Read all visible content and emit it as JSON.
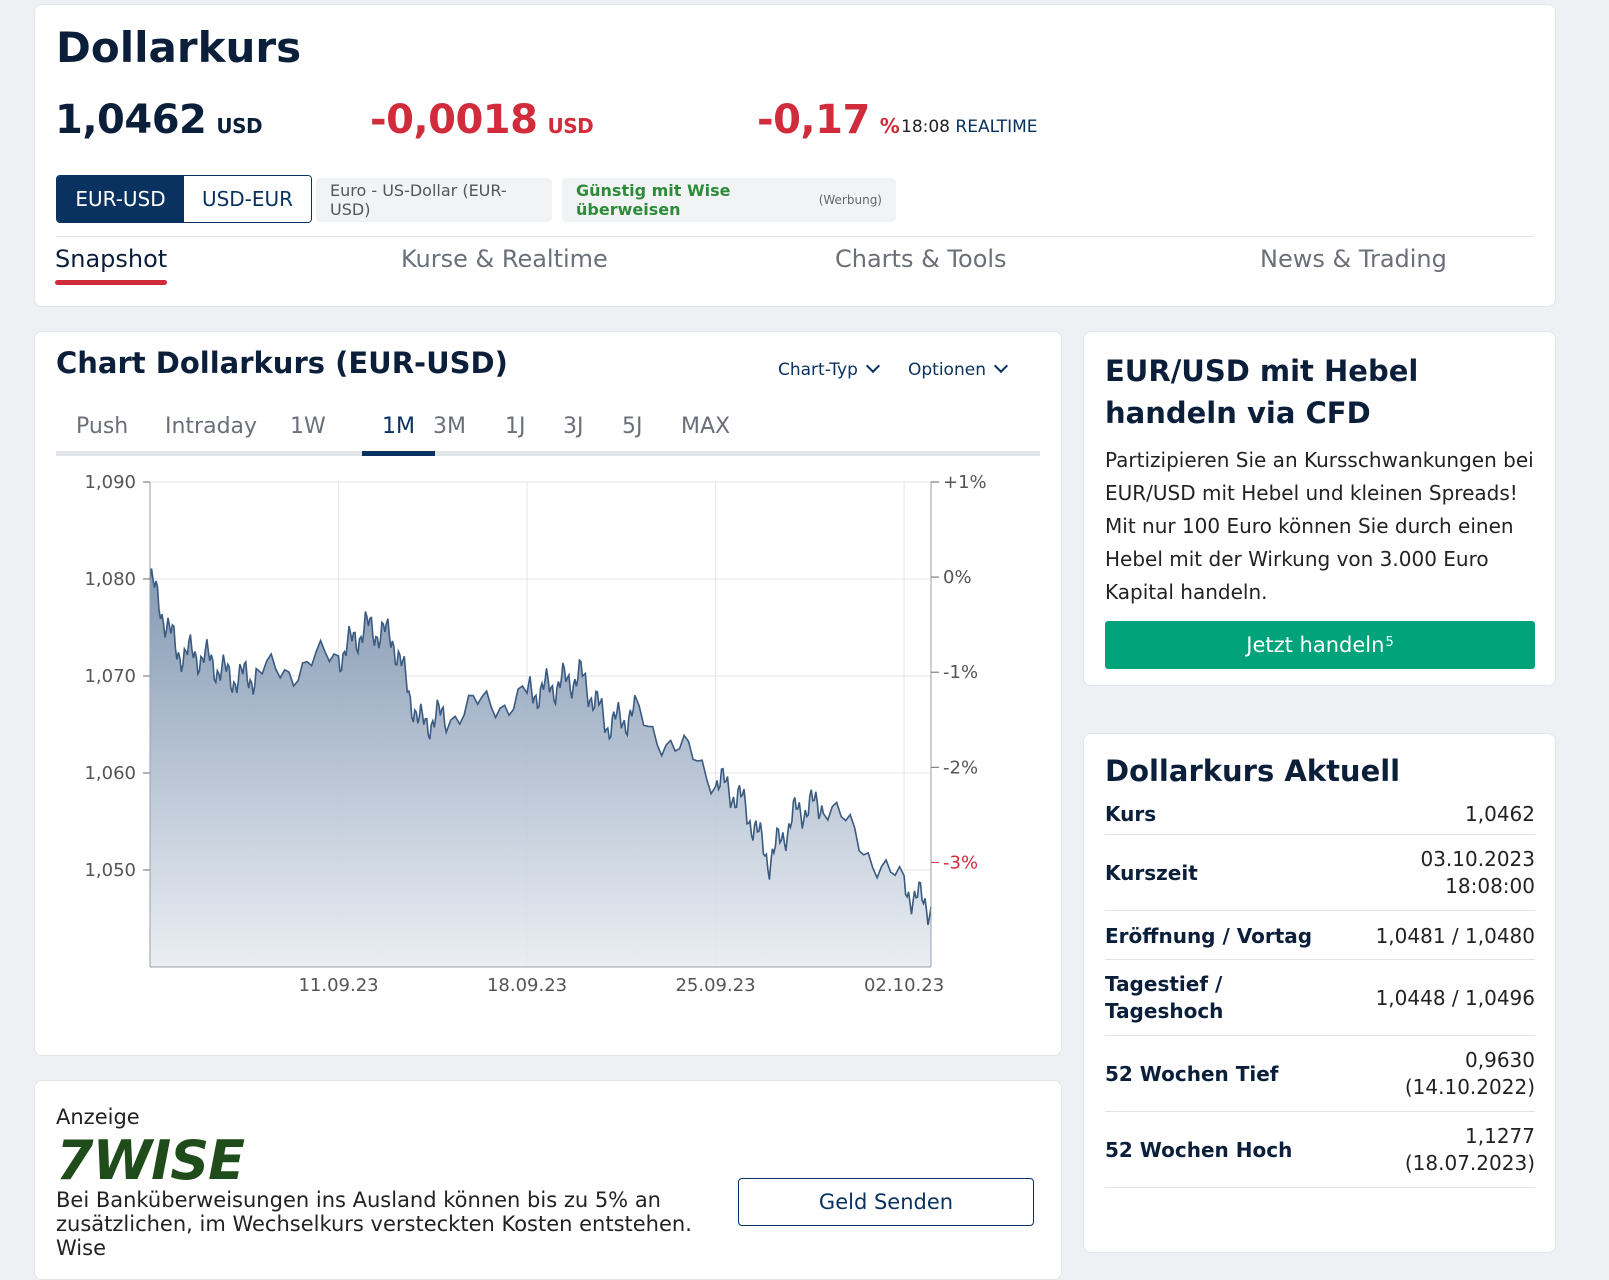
{
  "header": {
    "title": "Dollarkurs",
    "price": "1,0462",
    "price_unit": "USD",
    "change_abs": "-0,0018",
    "change_abs_unit": "USD",
    "change_pct": "-0,17",
    "change_pct_unit": "%",
    "time": "18:08",
    "realtime_label": "REALTIME",
    "toggle_eurusd": "EUR-USD",
    "toggle_usdeur": "USD-EUR",
    "pair_chip": "Euro - US-Dollar (EUR-USD)",
    "wise_chip": "Günstig mit Wise überweisen",
    "wise_chip_note": "(Werbung)",
    "tabs": [
      "Snapshot",
      "Kurse & Realtime",
      "Charts & Tools",
      "News & Trading"
    ],
    "active_tab": "Snapshot",
    "down_color": "#d02c3b",
    "accent_color": "#0a3260"
  },
  "chart_card": {
    "title": "Chart Dollarkurs (EUR-USD)",
    "chart_type_label": "Chart-Typ",
    "options_label": "Optionen",
    "ranges": [
      "Push",
      "Intraday",
      "1W",
      "1M",
      "3M",
      "1J",
      "3J",
      "5J",
      "MAX"
    ],
    "active_range": "1M"
  },
  "chart_data": {
    "type": "area",
    "x": [
      "2023-09-04",
      "2023-09-05",
      "2023-09-06",
      "2023-09-07",
      "2023-09-08",
      "2023-09-11",
      "2023-09-12",
      "2023-09-13",
      "2023-09-14",
      "2023-09-15",
      "2023-09-18",
      "2023-09-19",
      "2023-09-20",
      "2023-09-21",
      "2023-09-22",
      "2023-09-25",
      "2023-09-26",
      "2023-09-27",
      "2023-09-28",
      "2023-09-29",
      "2023-10-02",
      "2023-10-03"
    ],
    "y": [
      1.08,
      1.0725,
      1.072,
      1.0698,
      1.07,
      1.072,
      1.075,
      1.074,
      1.065,
      1.066,
      1.068,
      1.069,
      1.07,
      1.065,
      1.066,
      1.0595,
      1.057,
      1.051,
      1.056,
      1.057,
      1.048,
      1.0462
    ],
    "xticks": [
      "11.09.23",
      "18.09.23",
      "25.09.23",
      "02.10.23"
    ],
    "yticks": [
      "1,090",
      "1,080",
      "1,070",
      "1,060",
      "1,050"
    ],
    "ytick_values": [
      1.09,
      1.08,
      1.07,
      1.06,
      1.05
    ],
    "y2ticks": [
      "+1%",
      "0%",
      "-1%",
      "-2%",
      "-3%"
    ],
    "y2tick_values": [
      1,
      0,
      -1,
      -2,
      -3
    ],
    "ylim": [
      1.04,
      1.09
    ],
    "y2lim": [
      -4.1,
      1.0
    ],
    "grid": true,
    "line_color": "#3a5a80"
  },
  "ad": {
    "label": "Anzeige",
    "brand": "7WISE",
    "text": "Bei Banküberweisungen ins Ausland können bis zu 5% an zusätzlichen, im Wechselkurs versteckten Kosten entstehen. Wise",
    "button": "Geld Senden"
  },
  "cfd": {
    "title": "EUR/USD mit Hebel handeln via CFD",
    "text": "Partizipieren Sie an Kursschwankungen bei EUR/USD mit Hebel und kleinen Spreads! Mit nur 100 Euro können Sie durch einen Hebel mit der Wirkung von 3.000 Euro Kapital handeln.",
    "button": "Jetzt handeln",
    "button_sup": "5"
  },
  "table": {
    "title": "Dollarkurs Aktuell",
    "rows": [
      {
        "key": "Kurs",
        "value": "1,0462",
        "value2": ""
      },
      {
        "key": "Kurszeit",
        "value": "03.10.2023",
        "value2": "18:08:00"
      },
      {
        "key": "Eröffnung / Vortag",
        "value": "1,0481 / 1,0480",
        "value2": ""
      },
      {
        "key": "Tagestief /",
        "key2": "Tageshoch",
        "value": "1,0448 / 1,0496",
        "value2": ""
      },
      {
        "key": "52 Wochen Tief",
        "value": "0,9630",
        "value2": "(14.10.2022)"
      },
      {
        "key": "52 Wochen Hoch",
        "value": "1,1277",
        "value2": "(18.07.2023)"
      }
    ]
  }
}
